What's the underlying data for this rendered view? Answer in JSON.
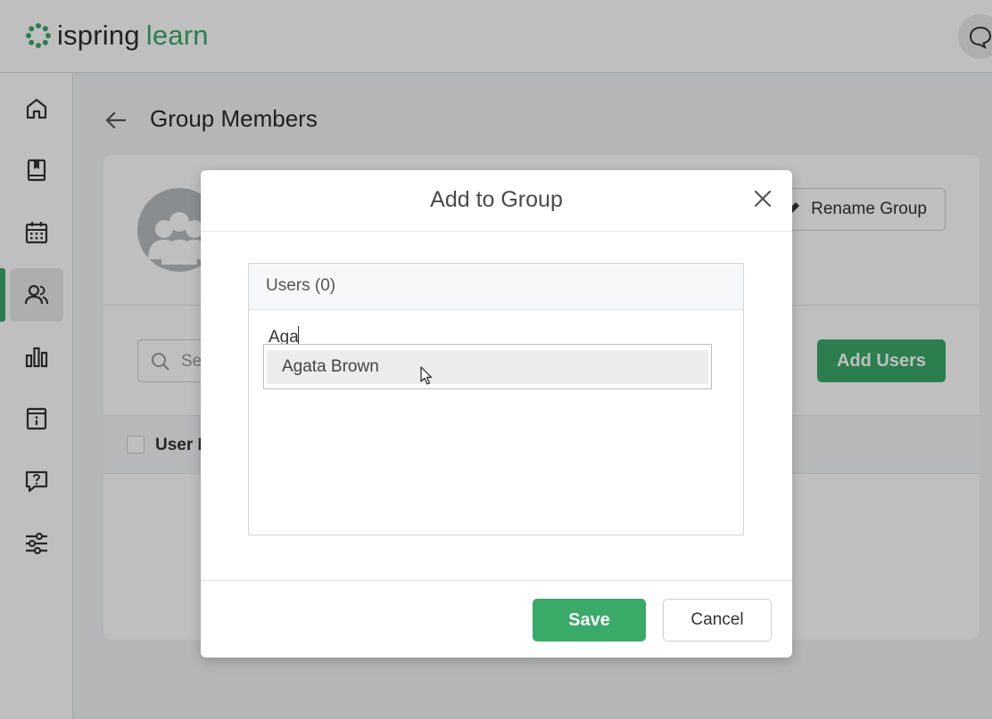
{
  "app": {
    "logo_word1": "ispring",
    "logo_word2": "learn",
    "brand_color": "#3aaa68"
  },
  "sidebar": {
    "items": [
      {
        "icon": "home-icon",
        "active": false
      },
      {
        "icon": "book-icon",
        "active": false
      },
      {
        "icon": "calendar-icon",
        "active": false
      },
      {
        "icon": "users-icon",
        "active": true
      },
      {
        "icon": "bar-chart-icon",
        "active": false
      },
      {
        "icon": "info-board-icon",
        "active": false
      },
      {
        "icon": "help-chat-icon",
        "active": false
      },
      {
        "icon": "sliders-icon",
        "active": false
      }
    ]
  },
  "page": {
    "title": "Group Members",
    "rename_label": "Rename Group",
    "search_placeholder": "Se",
    "add_users_label": "Add Users",
    "table_col_user": "User N"
  },
  "modal": {
    "title": "Add to Group",
    "users_header": "Users (0)",
    "input_value": "Aga",
    "suggestion": "Agata Brown",
    "save_label": "Save",
    "cancel_label": "Cancel"
  }
}
